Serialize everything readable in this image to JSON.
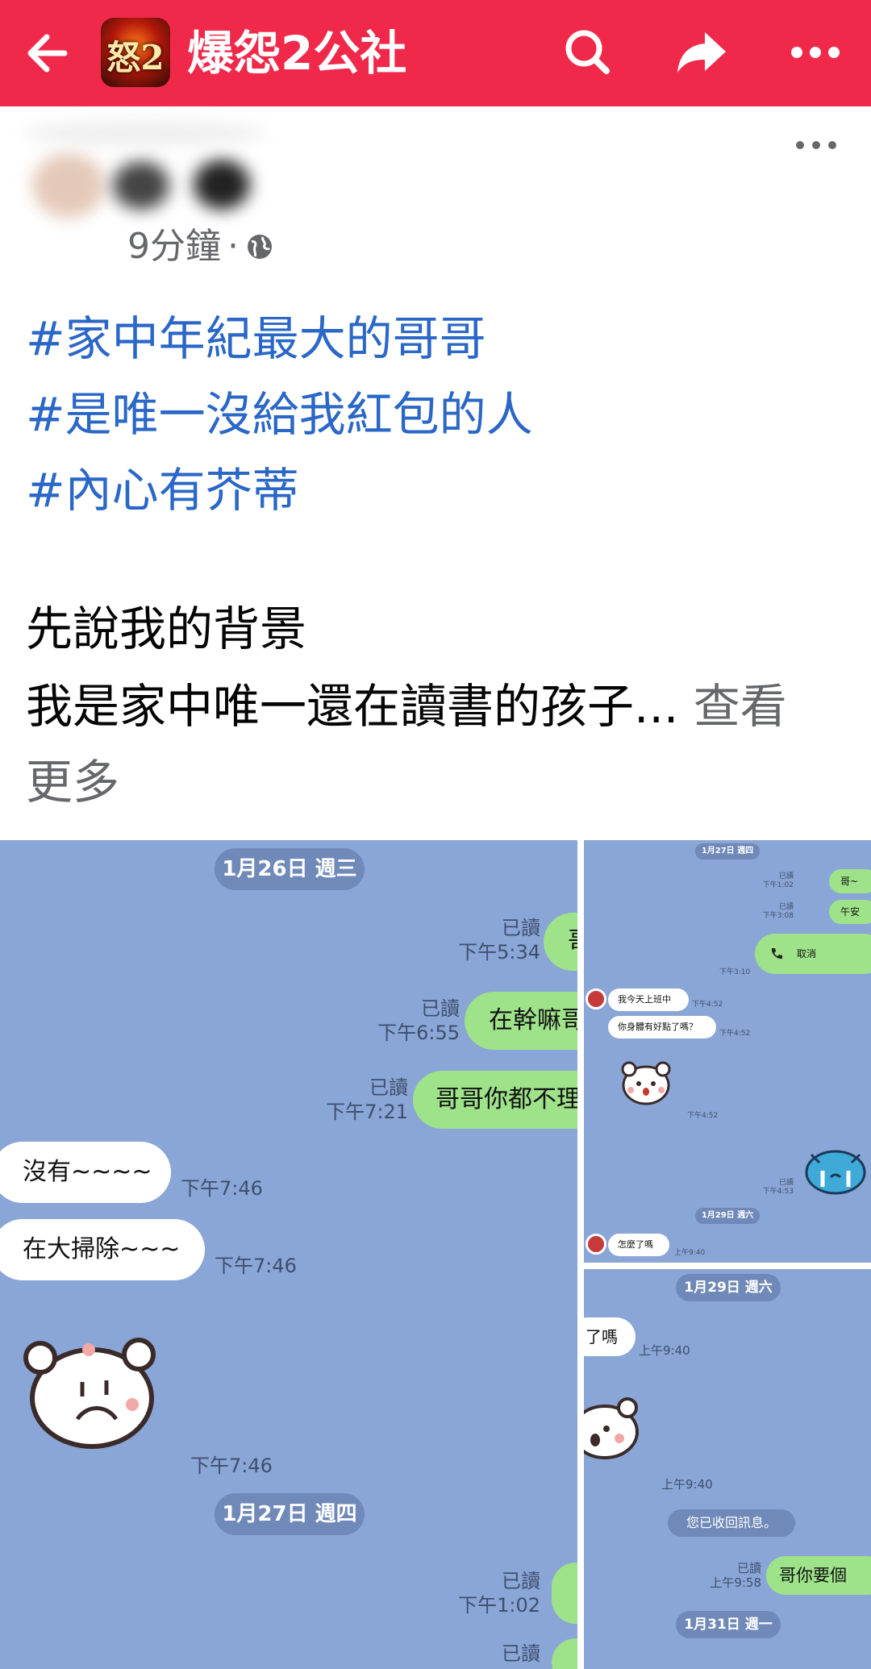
{
  "header": {
    "back_icon": "arrow-left-icon",
    "group_avatar_text": "怒2",
    "title": "爆怨2公社",
    "search_icon": "search-icon",
    "share_icon": "share-arrow-icon",
    "more_icon": "more-horizontal-icon"
  },
  "colors": {
    "topbar": "#f0294b",
    "hashtag": "#2a67c7",
    "chat_bg": "#8aa6d6",
    "bubble_green": "#9ee28a"
  },
  "post": {
    "time": "9分鐘",
    "separator": "·",
    "privacy_icon": "globe-icon",
    "hashtags": [
      "#家中年紀最大的哥哥",
      "#是唯一沒給我紅包的人",
      "#內心有芥蒂"
    ],
    "lines": [
      "先說我的背景",
      "我是家中唯一還在讀書的孩子..."
    ],
    "see_more_a": "查看",
    "see_more_b": "更多"
  },
  "photo_main": {
    "date1": "1月26日 週三",
    "msgs": [
      {
        "read": "已讀",
        "time": "下午5:34",
        "text": "哥"
      },
      {
        "read": "已讀",
        "time": "下午6:55",
        "text": "在幹嘛哥"
      },
      {
        "read": "已讀",
        "time": "下午7:21",
        "text": "哥哥你都不理"
      }
    ],
    "replies": [
      {
        "text": "沒有~~~~",
        "time": "下午7:46"
      },
      {
        "text": "在大掃除~~~",
        "time": "下午7:46"
      }
    ],
    "sticker_time": "下午7:46",
    "date2": "1月27日 週四",
    "tail": [
      {
        "read": "已讀",
        "time": "下午1:02"
      },
      {
        "read": "已讀"
      }
    ]
  },
  "photo_tr": {
    "date1": "1月27日 週四",
    "msgs": [
      {
        "read": "已讀",
        "time": "下午1:02",
        "text": "哥~"
      },
      {
        "read": "已讀",
        "time": "下午3:08",
        "text": "午安"
      }
    ],
    "call_text": "取消",
    "call_time": "下午3:10",
    "replies": [
      {
        "text": "我今天上班中",
        "time": "下午4:52"
      },
      {
        "text": "你身體有好點了嗎？",
        "time": "下午4:52"
      }
    ],
    "sticker_time": "下午4:52",
    "read2": "已讀",
    "time2": "下午4:53",
    "date2": "1月29日 週六",
    "last_reply": "怎麼了嗎",
    "last_time": "上午9:40"
  },
  "photo_br": {
    "date1": "1月29日 週六",
    "reply": "了嗎",
    "reply_time": "上午9:40",
    "sticker_time": "上午9:40",
    "recall": "您已收回訊息。",
    "read": "已讀",
    "time": "上午9:58",
    "msg": "哥你要個",
    "date2": "1月31日 週一"
  }
}
